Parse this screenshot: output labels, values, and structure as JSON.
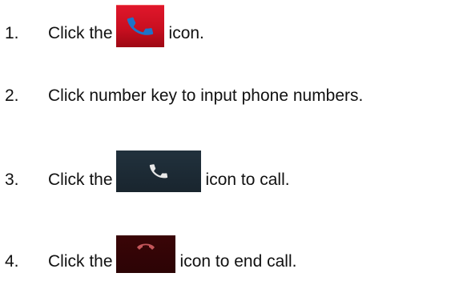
{
  "steps": [
    {
      "number": "1.",
      "before": "Click the",
      "icon": "phone-icon",
      "after": "icon."
    },
    {
      "number": "2.",
      "text": "Click number key to input phone numbers."
    },
    {
      "number": "3.",
      "before": "Click the",
      "icon": "call-icon",
      "after": "icon to call."
    },
    {
      "number": "4.",
      "before": "Click the",
      "icon": "end-call-icon",
      "after": "icon to end call."
    }
  ],
  "colors": {
    "phone_icon_bg": "#d3121f",
    "phone_icon_glyph": "#1e73c8",
    "call_icon_bg": "#1c2a35",
    "call_icon_glyph": "#e8e8e8",
    "end_call_icon_bg": "#330405",
    "end_call_icon_glyph": "#c4565a"
  }
}
